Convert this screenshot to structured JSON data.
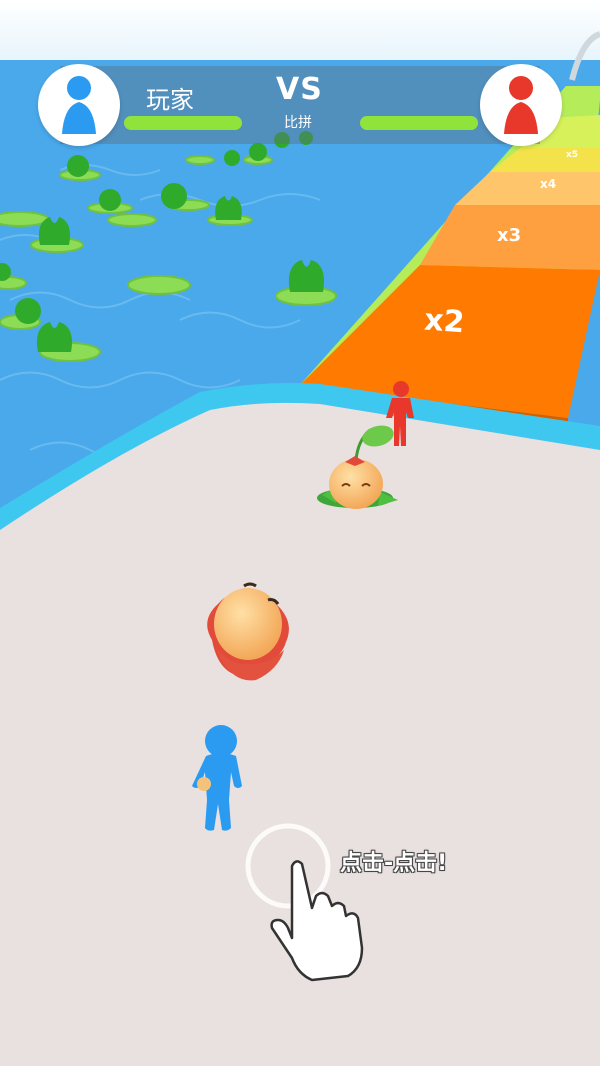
{
  "hud": {
    "player_label": "玩家",
    "vs_label": "VS",
    "vs_sub_label": "比拼",
    "player_progress": 1.0,
    "opponent_progress": 1.0,
    "player_color": "#2a9bf0",
    "opponent_color": "#e8372b",
    "progress_color": "#8fe33a"
  },
  "track": {
    "multipliers": [
      "x2",
      "x3",
      "x4",
      "x5"
    ],
    "colors": [
      "#ff7a00",
      "#ffa040",
      "#ffc56a",
      "#f3e24a",
      "#b4ec5a"
    ]
  },
  "hint": {
    "text": "点击-点击!",
    "icon": "tap-hand-icon"
  },
  "colors": {
    "water": "#4aa9ea",
    "floor": "#e8e1df",
    "rim": "#3fc8ef"
  }
}
